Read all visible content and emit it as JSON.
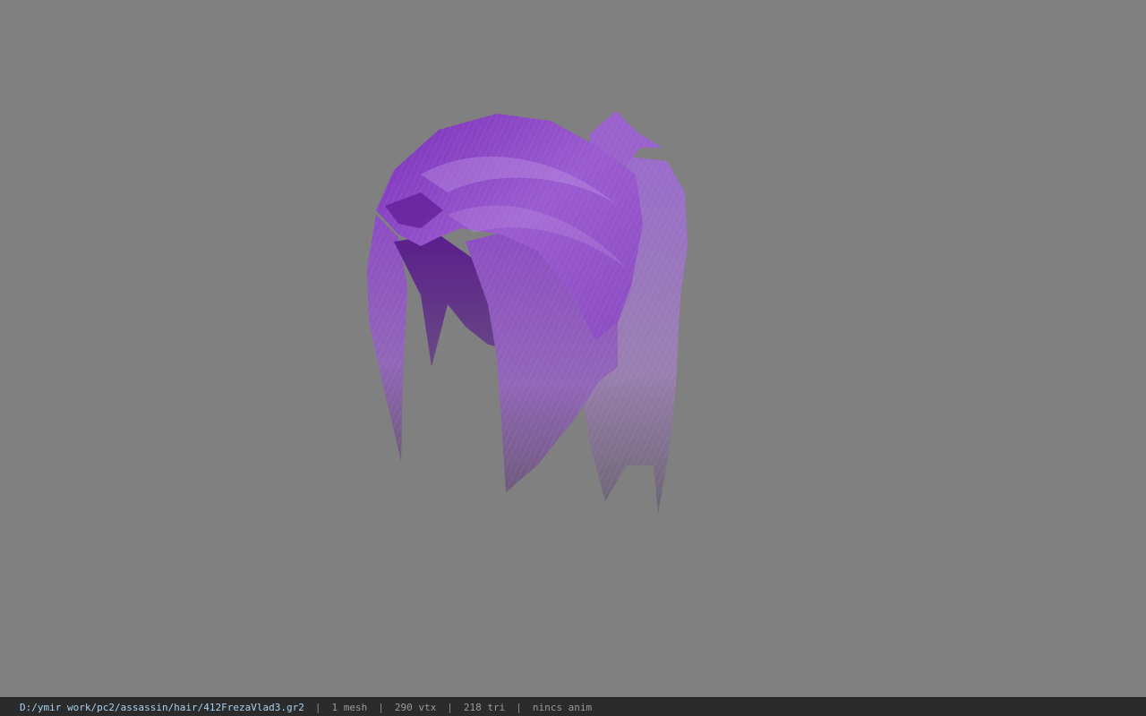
{
  "viewer": {
    "background_color": "#808080",
    "model_tint": "#8e44c8"
  },
  "status": {
    "file_path": "D:/ymir work/pc2/assassin/hair/412FrezaVlad3.gr2",
    "separator": "|",
    "mesh_count": "1 mesh",
    "vertex_count": "290 vtx",
    "triangle_count": "218 tri",
    "anim_status": "nincs anim"
  }
}
